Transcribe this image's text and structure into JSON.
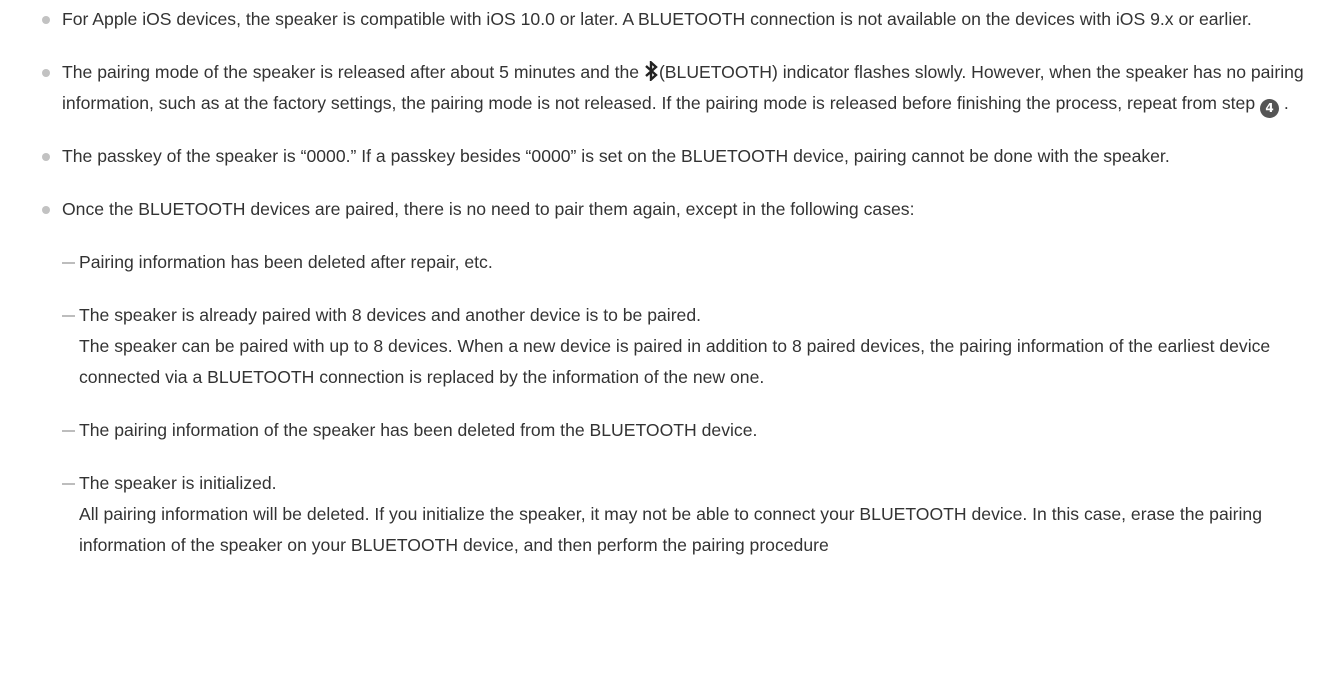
{
  "notes": [
    {
      "text": "For Apple iOS devices, the speaker is compatible with iOS 10.0 or later. A BLUETOOTH connection is not available on the devices with iOS 9.x or earlier."
    },
    {
      "before_icon": "The pairing mode of the speaker is released after about 5 minutes and the ",
      "icon": "bluetooth-icon",
      "after_icon": "(BLUETOOTH) indicator flashes slowly. However, when the speaker has no pairing information, such as at the factory settings, the pairing mode is not released. If the pairing mode is released before finishing the process, repeat from step ",
      "step": "4",
      "end": " ."
    },
    {
      "text": "The passkey of the speaker is “0000.” If a passkey besides “0000” is set on the BLUETOOTH device, pairing cannot be done with the speaker."
    },
    {
      "text": "Once the BLUETOOTH devices are paired, there is no need to pair them again, except in the following cases:",
      "cases": [
        {
          "text": "Pairing information has been deleted after repair, etc."
        },
        {
          "text": "The speaker is already paired with 8 devices and another device is to be paired.",
          "detail": "The speaker can be paired with up to 8 devices. When a new device is paired in addition to 8 paired devices, the pairing information of the earliest device connected via a BLUETOOTH connection is replaced by the information of the new one."
        },
        {
          "text": "The pairing information of the speaker has been deleted from the BLUETOOTH device."
        },
        {
          "text": "The speaker is initialized.",
          "detail": "All pairing information will be deleted. If you initialize the speaker, it may not be able to connect your BLUETOOTH device. In this case, erase the pairing information of the speaker on your BLUETOOTH device, and then perform the pairing procedure"
        }
      ]
    }
  ]
}
